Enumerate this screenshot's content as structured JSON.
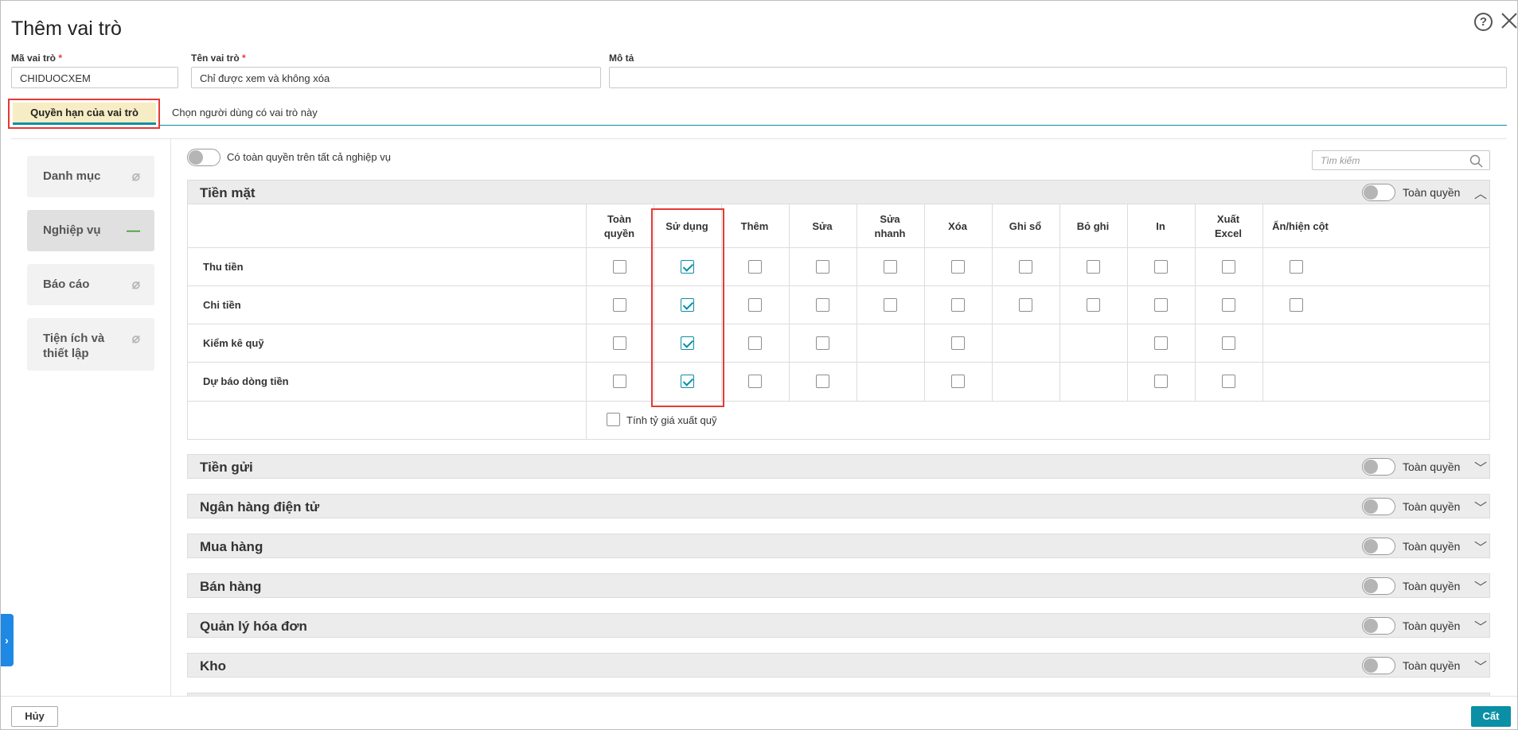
{
  "dialog": {
    "title": "Thêm vai trò",
    "help_icon": "question-circle-icon",
    "close_icon": "close-icon"
  },
  "form": {
    "code": {
      "label": "Mã vai trò",
      "required_mark": "*",
      "value": "CHIDUOCXEM"
    },
    "name": {
      "label": "Tên vai trò",
      "required_mark": "*",
      "value": "Chỉ được xem và không xóa"
    },
    "desc": {
      "label": "Mô tả",
      "value": ""
    }
  },
  "tabs": [
    {
      "label": "Quyền hạn của vai trò",
      "active": true
    },
    {
      "label": "Chọn người dùng có vai trò này",
      "active": false
    }
  ],
  "sidebar": {
    "items": [
      {
        "label": "Danh mục",
        "status": "⌀"
      },
      {
        "label": "Nghiệp vụ",
        "status": "—",
        "active": true
      },
      {
        "label": "Báo cáo",
        "status": "⌀"
      },
      {
        "label": "Tiện ích và thiết lập",
        "status": "⌀"
      }
    ]
  },
  "main": {
    "all_perm_label": "Có toàn quyền trên tất cả nghiệp vụ",
    "search_placeholder": "Tìm kiếm",
    "full_perm_label": "Toàn quyền",
    "open_section": {
      "title": "Tiền mặt",
      "columns": [
        [
          "Toàn",
          "quyền"
        ],
        [
          "Sử dụng",
          ""
        ],
        [
          "Thêm",
          ""
        ],
        [
          "Sửa",
          ""
        ],
        [
          "Sửa",
          "nhanh"
        ],
        [
          "Xóa",
          ""
        ],
        [
          "Ghi sổ",
          ""
        ],
        [
          "Bỏ ghi",
          ""
        ],
        [
          "In",
          ""
        ],
        [
          "Xuất",
          "Excel"
        ],
        [
          "Ẩn/hiện cột",
          ""
        ]
      ],
      "rows": [
        {
          "label": "Thu tiền",
          "cells": [
            0,
            1,
            0,
            0,
            0,
            0,
            0,
            0,
            0,
            0,
            0
          ]
        },
        {
          "label": "Chi tiền",
          "cells": [
            0,
            1,
            0,
            0,
            0,
            0,
            0,
            0,
            0,
            0,
            0
          ]
        },
        {
          "label": "Kiểm kê quỹ",
          "cells": [
            0,
            1,
            0,
            0,
            null,
            0,
            null,
            null,
            0,
            0,
            null
          ]
        },
        {
          "label": "Dự báo dòng tiền",
          "cells": [
            0,
            1,
            0,
            0,
            null,
            0,
            null,
            null,
            0,
            0,
            null
          ]
        }
      ],
      "extra_option": "Tính tỷ giá xuất quỹ"
    },
    "sections": [
      "Tiền gửi",
      "Ngân hàng điện tử",
      "Mua hàng",
      "Bán hàng",
      "Quản lý hóa đơn",
      "Kho"
    ]
  },
  "footer": {
    "cancel": "Hủy",
    "save": "Cất"
  },
  "colors": {
    "accent": "#0a8fa6",
    "highlight": "#e53935",
    "save_bg": "#0a8fa6",
    "expand_tab": "#1e88e5"
  }
}
